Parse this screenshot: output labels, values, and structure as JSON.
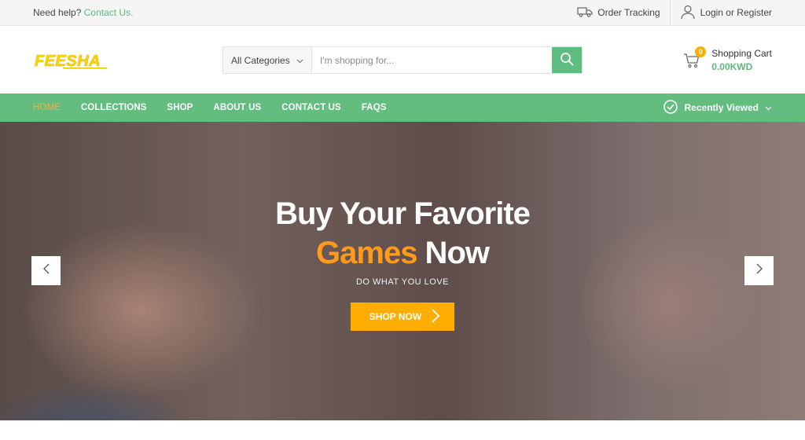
{
  "topbar": {
    "help_text": "Need help?",
    "help_link": "Contact Us.",
    "order_tracking": "Order Tracking",
    "login": "Login or Register"
  },
  "header": {
    "logo_text": "FEESHA",
    "category_select": "All Categories",
    "search_placeholder": "I'm shopping for...",
    "cart_count": "0",
    "cart_label": "Shopping Cart",
    "cart_amount": "0.00KWD"
  },
  "nav": {
    "items": [
      "HOME",
      "COLLECTIONS",
      "SHOP",
      "ABOUT US",
      "CONTACT US",
      "FAQS"
    ],
    "active_index": 0,
    "recently_viewed": "Recently Viewed"
  },
  "hero": {
    "line1": "Buy Your Favorite",
    "line2_highlight": "Games",
    "line2_rest": " Now",
    "subtitle": "DO WHAT YOU LOVE",
    "button": "SHOP NOW"
  },
  "colors": {
    "brand_green": "#63bd7f",
    "accent_orange": "#ffae00",
    "logo_yellow": "#ffd400"
  },
  "icons": {
    "truck": "truck-icon",
    "user": "user-icon",
    "search": "search-icon",
    "cart": "cart-icon",
    "clock": "clock-icon",
    "chevron_down": "chevron-down-icon",
    "prev": "chevron-left-icon",
    "next": "chevron-right-icon"
  }
}
